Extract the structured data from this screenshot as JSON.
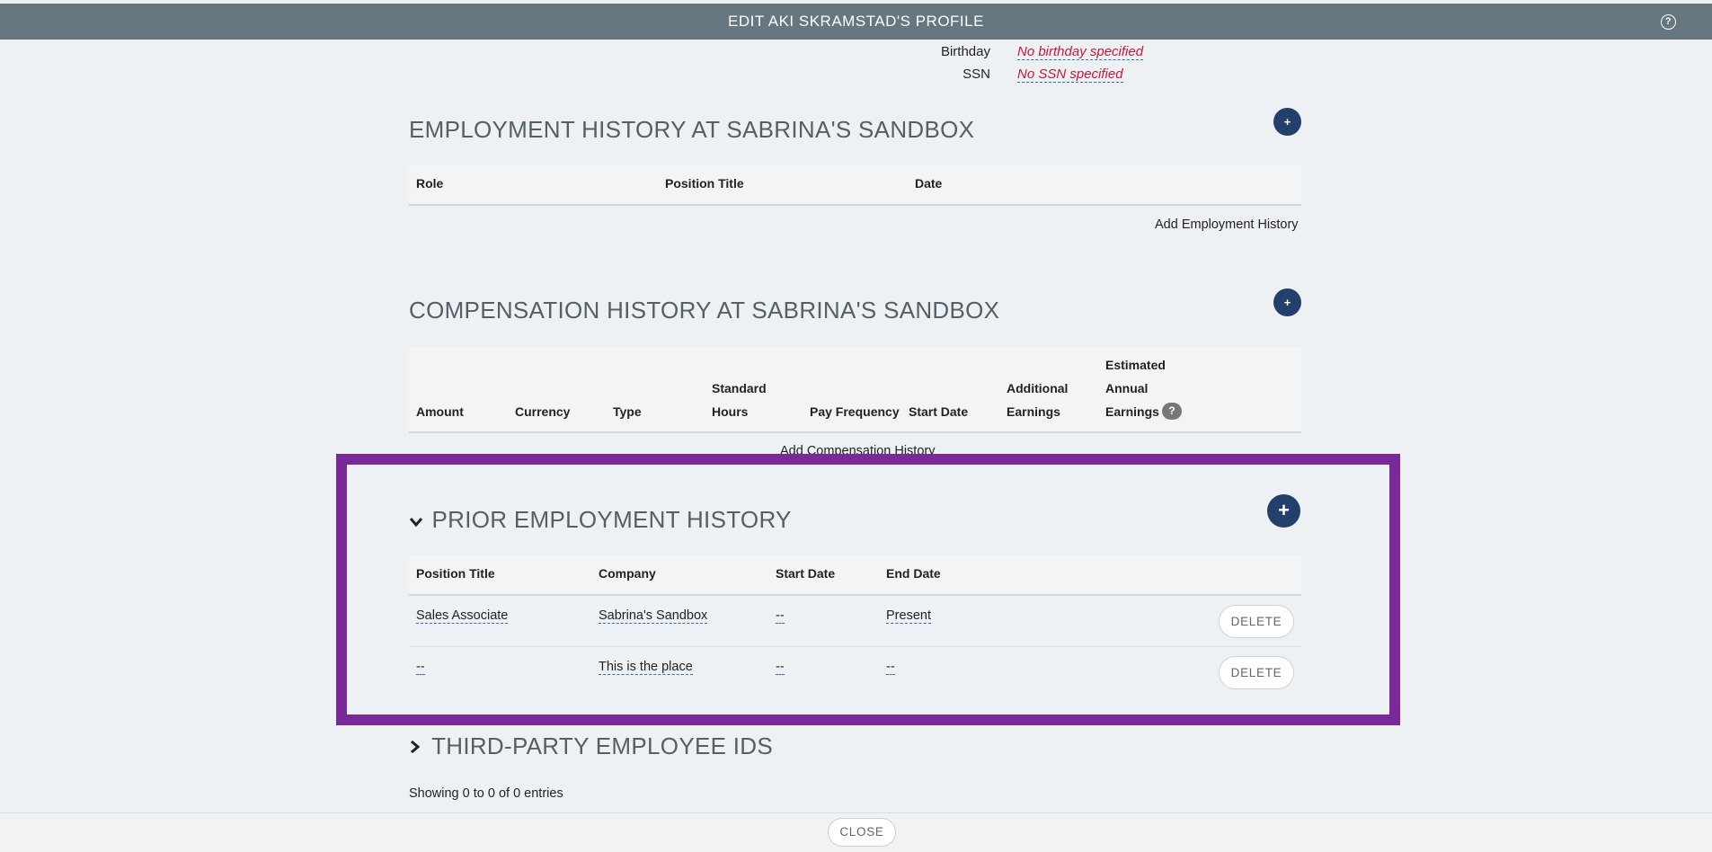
{
  "header": {
    "title": "EDIT AKI SKRAMSTAD'S PROFILE",
    "help_icon": "question-circle-icon"
  },
  "personal": {
    "birthday_label": "Birthday",
    "birthday_value": "No birthday specified",
    "ssn_label": "SSN",
    "ssn_value": "No SSN specified"
  },
  "employment": {
    "title": "EMPLOYMENT HISTORY AT SABRINA'S SANDBOX",
    "add_icon": "+",
    "columns": [
      "Role",
      "Position Title",
      "Date"
    ],
    "add_link": "Add Employment History"
  },
  "compensation": {
    "title": "COMPENSATION HISTORY AT SABRINA'S SANDBOX",
    "add_icon": "+",
    "columns": [
      "Amount",
      "Currency",
      "Type",
      "Standard",
      "Hours",
      "Pay Frequency",
      "Start Date",
      "Additional",
      "Earnings",
      "Estimated",
      "Annual",
      "Earnings"
    ],
    "info_icon": "?",
    "add_link": "Add Compensation History"
  },
  "prior": {
    "chevron": "⌄",
    "title": "PRIOR EMPLOYMENT HISTORY",
    "add_icon": "+",
    "columns": [
      "Position Title",
      "Company",
      "Start Date",
      "End Date"
    ],
    "rows": [
      {
        "position": "Sales Associate",
        "company": "Sabrina's Sandbox",
        "start": "--",
        "end": "Present",
        "action": "DELETE"
      },
      {
        "position": "--",
        "company": "This is the place",
        "start": "--",
        "end": "--",
        "action": "DELETE"
      }
    ]
  },
  "third_party": {
    "chevron": "›",
    "title": "THIRD-PARTY EMPLOYEE IDS",
    "entries_text": "Showing 0 to 0 of 0 entries"
  },
  "footer": {
    "close_label": "CLOSE"
  },
  "colors": {
    "topbar": "#66777f",
    "accent": "#233f6b",
    "highlight_frame": "#7a2a98",
    "missing_value": "#c8173a"
  }
}
